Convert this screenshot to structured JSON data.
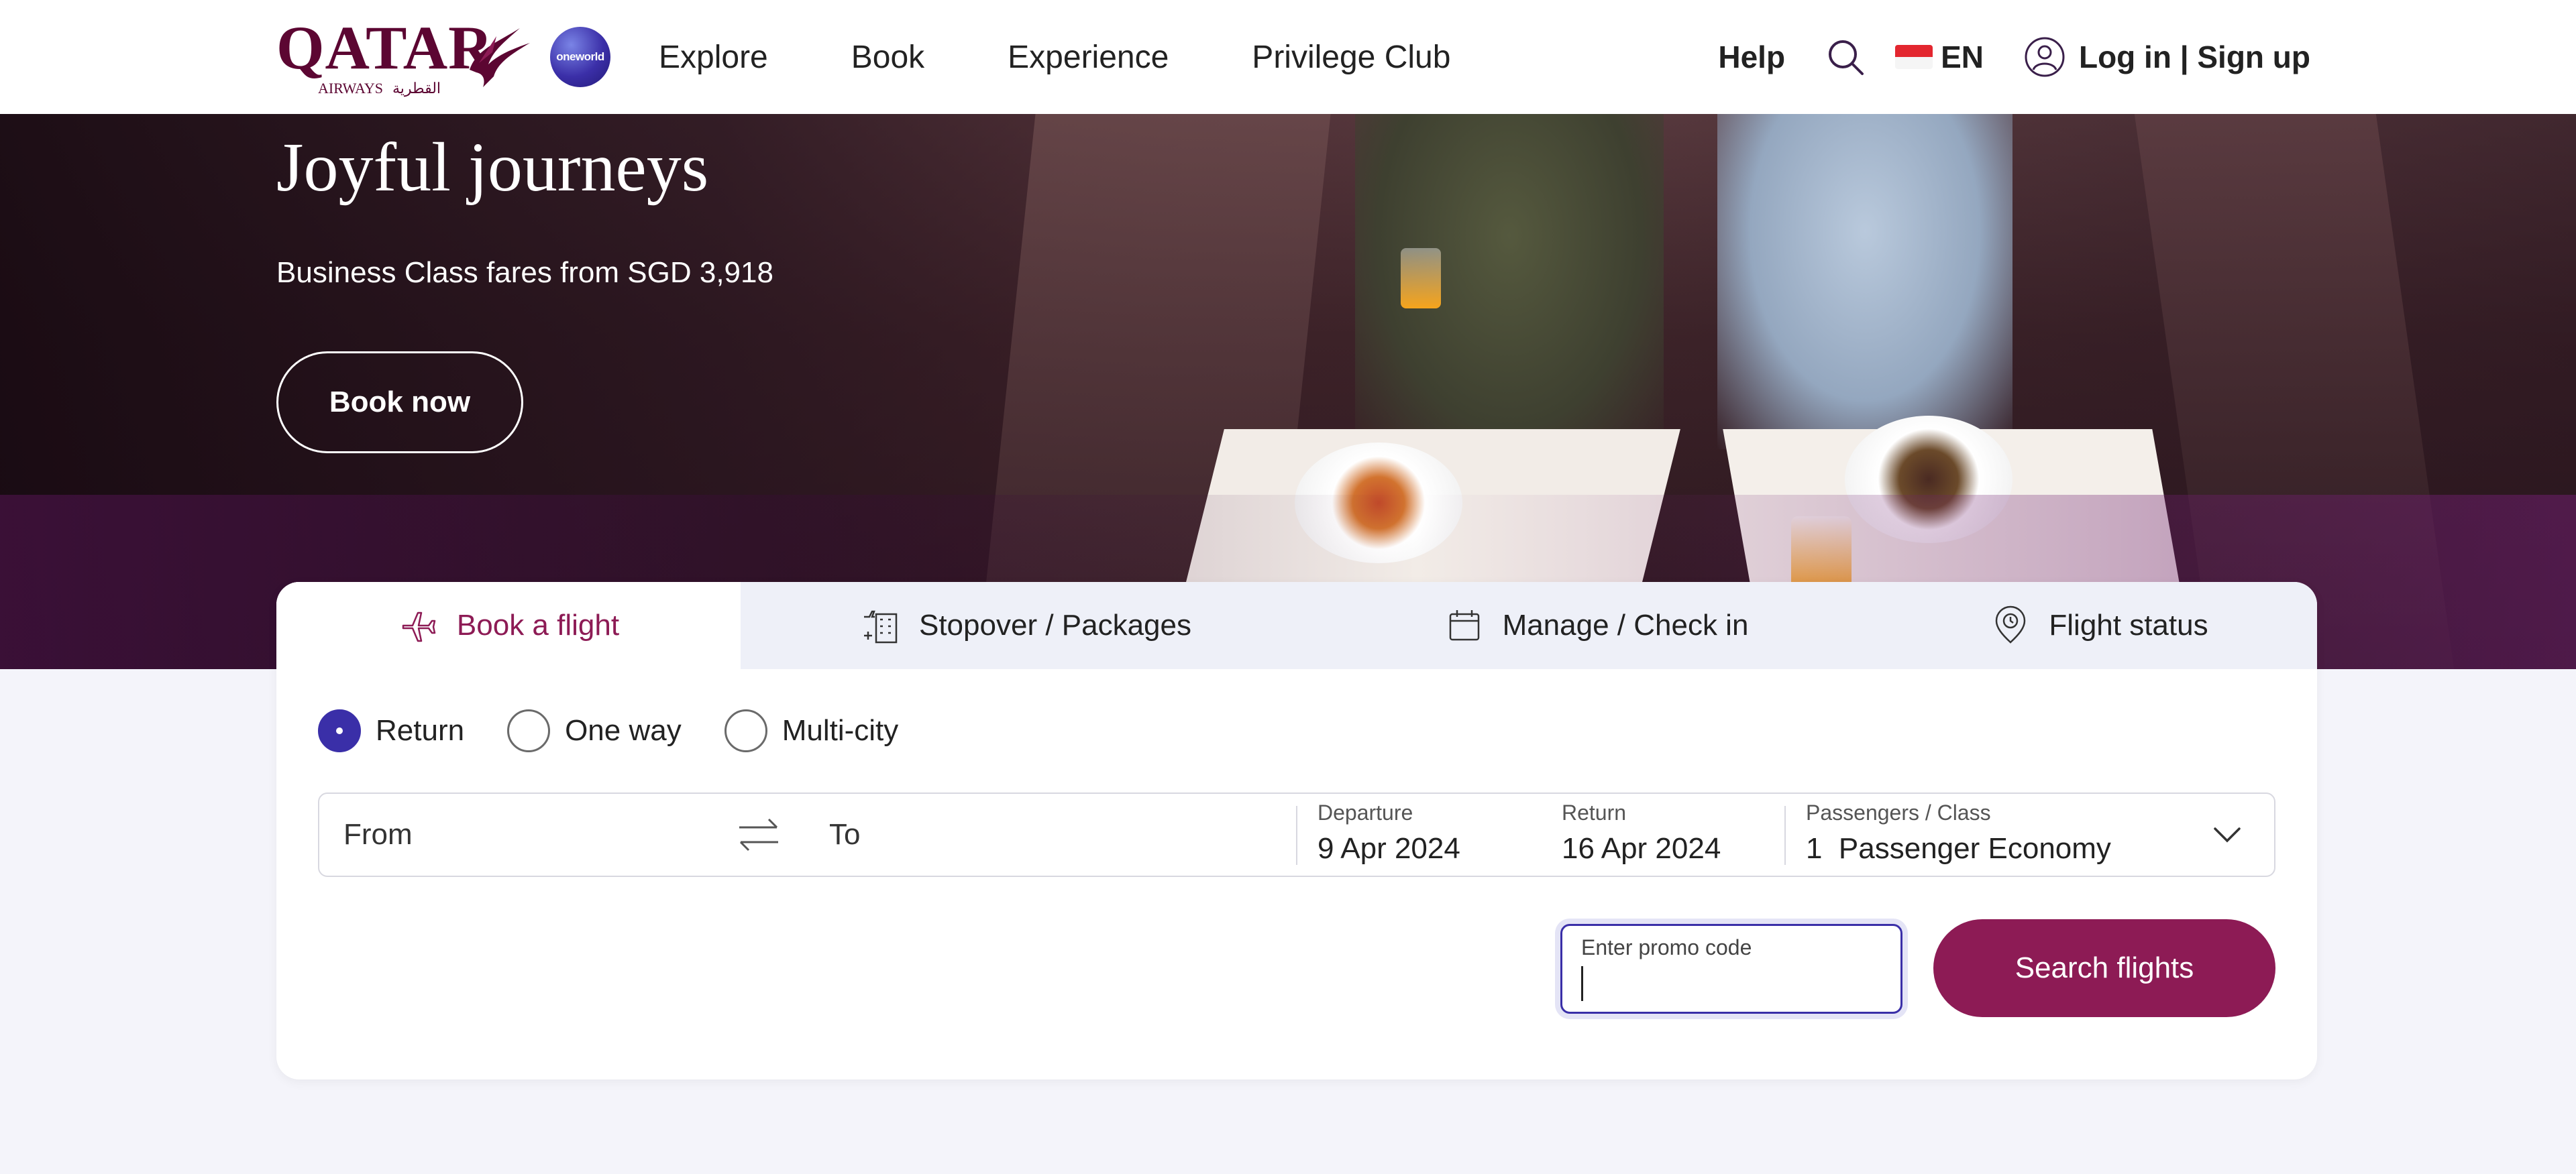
{
  "header": {
    "logo_text": "QATAR",
    "logo_sub_en": "AIRWAYS",
    "logo_sub_ar": "القطرية",
    "alliance_badge": "oneworld",
    "nav": [
      "Explore",
      "Book",
      "Experience",
      "Privilege Club"
    ],
    "help": "Help",
    "language": "EN",
    "login": "Log in | Sign up",
    "icons": [
      "search-icon",
      "singapore-flag-icon",
      "user-icon"
    ]
  },
  "hero": {
    "title": "Joyful journeys",
    "subtitle": "Business Class fares from SGD 3,918",
    "cta": "Book now"
  },
  "booking": {
    "tabs": [
      {
        "label": "Book a flight",
        "icon": "plane-icon",
        "active": true
      },
      {
        "label": "Stopover / Packages",
        "icon": "hotel-icon",
        "active": false
      },
      {
        "label": "Manage / Check in",
        "icon": "calendar-icon",
        "active": false
      },
      {
        "label": "Flight status",
        "icon": "location-pin-icon",
        "active": false
      }
    ],
    "trip_types": [
      {
        "label": "Return",
        "checked": true
      },
      {
        "label": "One way",
        "checked": false
      },
      {
        "label": "Multi-city",
        "checked": false
      }
    ],
    "from_placeholder": "From",
    "to_placeholder": "To",
    "departure": {
      "label": "Departure",
      "value": "9 Apr 2024"
    },
    "return": {
      "label": "Return",
      "value": "16 Apr 2024"
    },
    "passengers": {
      "label": "Passengers / Class",
      "value": "1  Passenger Economy"
    },
    "promo": {
      "label": "Enter promo code",
      "value": ""
    },
    "search_button": "Search flights"
  },
  "colors": {
    "brand": "#8d1b55",
    "brand_dark": "#5c0632",
    "accent": "#3a2fa8",
    "page_bg": "#f4f4fa"
  }
}
